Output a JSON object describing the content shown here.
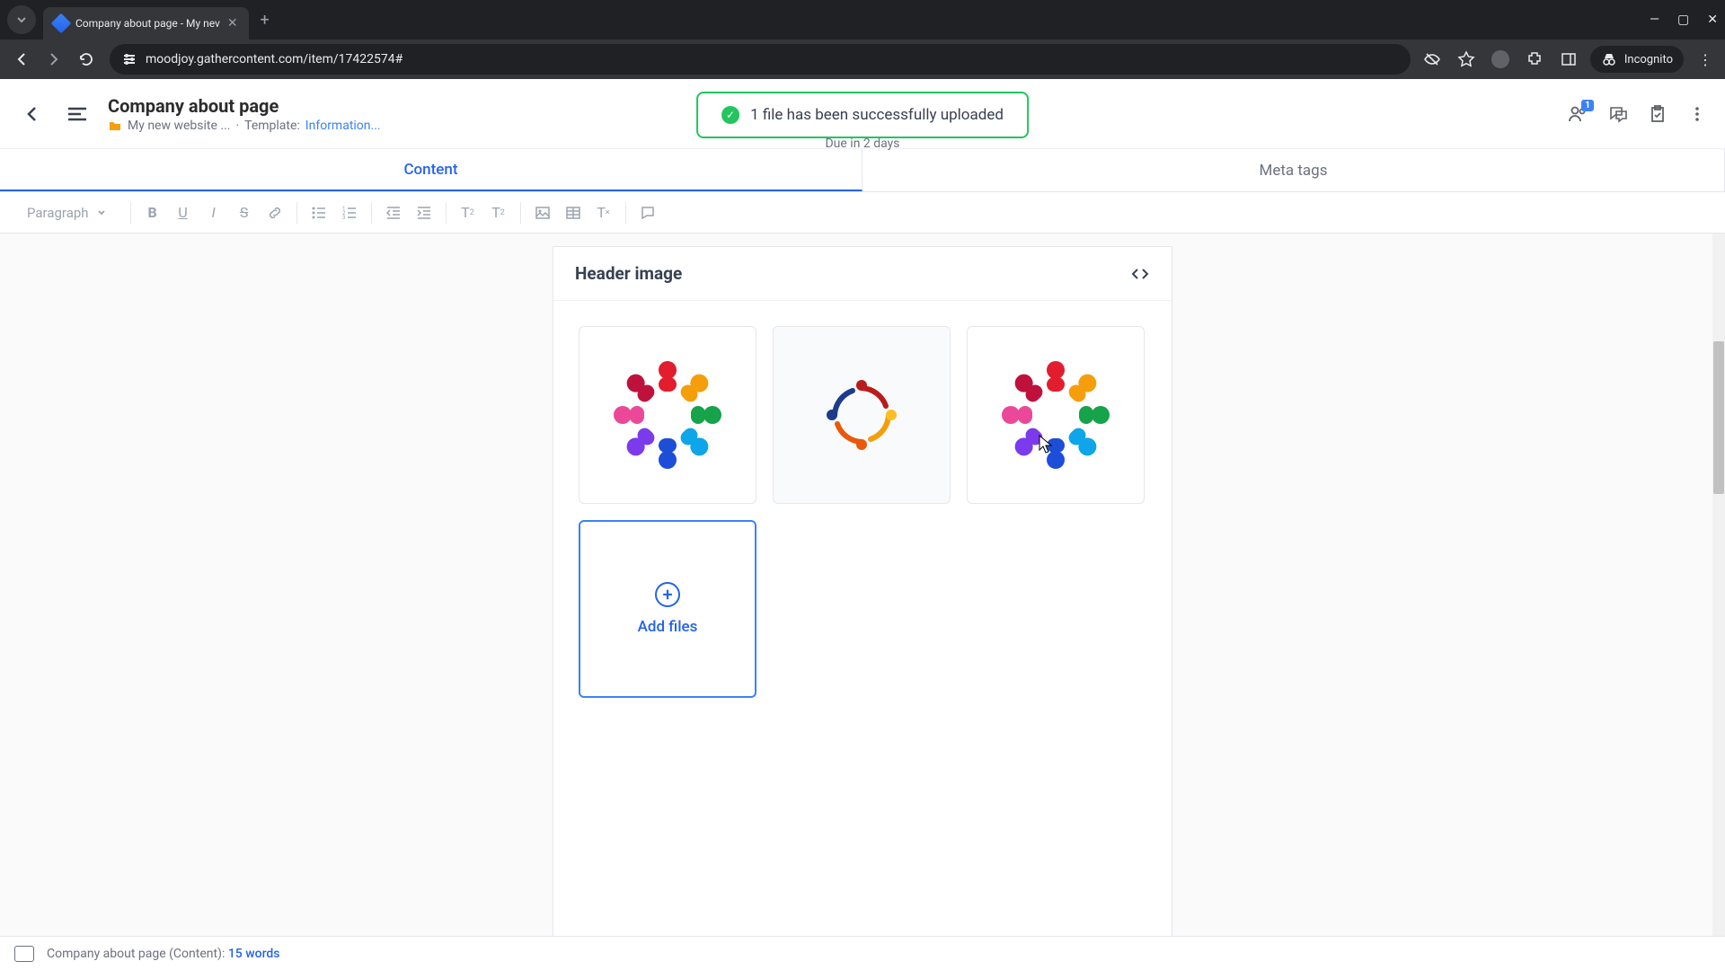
{
  "browser": {
    "tab_title": "Company about page - My nev",
    "url": "moodjoy.gathercontent.com/item/17422574#",
    "incognito_label": "Incognito"
  },
  "header": {
    "title": "Company about page",
    "crumb_project": "My new website ...",
    "crumb_separator": "·",
    "template_label": "Template:",
    "template_name": "Information...",
    "due_text": "Due in 2 days",
    "share_badge": "1"
  },
  "toast": {
    "message": "1 file has been successfully uploaded"
  },
  "tabs": {
    "content": "Content",
    "meta": "Meta tags"
  },
  "toolbar": {
    "format_select": "Paragraph"
  },
  "card": {
    "title": "Header image"
  },
  "add_files": {
    "label": "Add files"
  },
  "status": {
    "context": "Company about page (Content):",
    "count": "15 words"
  }
}
